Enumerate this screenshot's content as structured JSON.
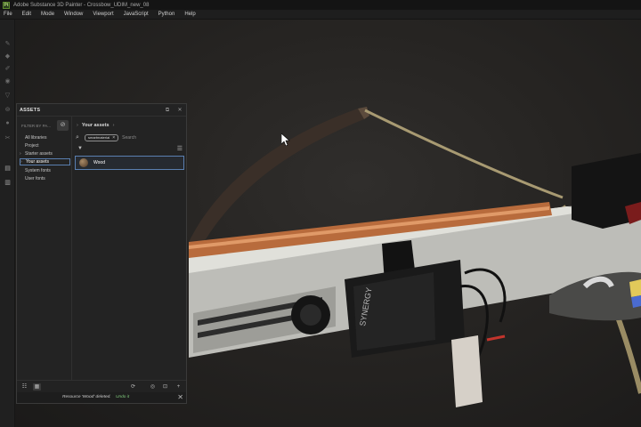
{
  "window": {
    "title": "Adobe Substance 3D Painter - Crossbow_UDIM_new_08",
    "app_icon_label": "Pt"
  },
  "menu": [
    "File",
    "Edit",
    "Mode",
    "Window",
    "Viewport",
    "JavaScript",
    "Python",
    "Help"
  ],
  "toolbar": {
    "icons": [
      "paint-brush-icon",
      "eraser-icon",
      "projection-icon",
      "polygon-fill-icon",
      "smudge-icon",
      "clone-icon",
      "color-picker-icon",
      "measure-icon",
      "assets-icon",
      "document-icon"
    ]
  },
  "assets_panel": {
    "title": "ASSETS",
    "filter_label": "FILTER BY PA...",
    "libraries": [
      {
        "label": "All libraries",
        "expandable": false,
        "selected": false
      },
      {
        "label": "Project",
        "expandable": false,
        "selected": false
      },
      {
        "label": "Starter assets",
        "expandable": true,
        "selected": false
      },
      {
        "label": "Your assets",
        "expandable": true,
        "selected": true
      },
      {
        "label": "System fonts",
        "expandable": false,
        "selected": false
      },
      {
        "label": "User fonts",
        "expandable": false,
        "selected": false
      }
    ],
    "breadcrumb": "Your assets",
    "search": {
      "chip": "smartmaterial",
      "placeholder": "Search"
    },
    "assets": [
      {
        "name": "Wood"
      }
    ],
    "status": {
      "message": "Resource 'Wood' deleted.",
      "undo_label": "Undo it"
    }
  },
  "colors": {
    "selection_border": "#5a7fb0",
    "undo_link": "#7fc77b",
    "panel_bg": "#232323"
  }
}
